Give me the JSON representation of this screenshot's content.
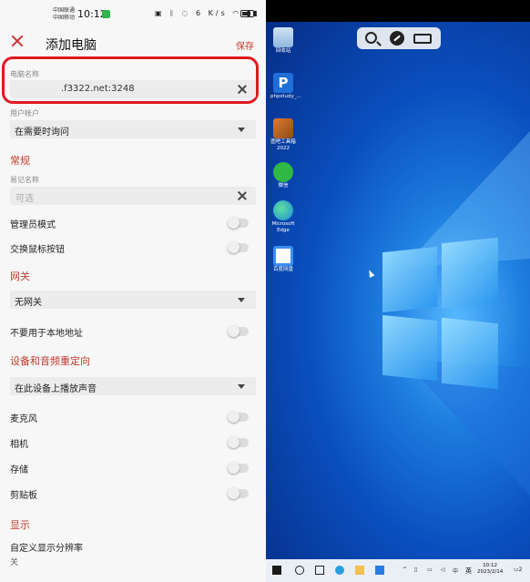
{
  "status_bar": {
    "carrier1": "中国联通",
    "carrier2": "中国移动",
    "time": "10:12",
    "speed": "6 K/s",
    "battery": "75"
  },
  "app_bar": {
    "title": "添加电脑",
    "save_label": "保存"
  },
  "form": {
    "pc_name_label": "电脑名称",
    "pc_name_value": ".f3322.net:3248",
    "user_account_label": "用户帐户",
    "user_account_value": "在需要时询问",
    "general_title": "常规",
    "friendly_name_label": "易记名称",
    "friendly_name_placeholder": "可选",
    "admin_mode_label": "管理员模式",
    "swap_mouse_label": "交换鼠标按钮",
    "gateway_title": "网关",
    "gateway_value": "无网关",
    "bypass_local_label": "不要用于本地地址",
    "redirect_title": "设备和音频重定向",
    "sound_value": "在此设备上播放声音",
    "mic_label": "麦克风",
    "camera_label": "相机",
    "storage_label": "存储",
    "clipboard_label": "剪贴板",
    "display_title": "显示",
    "custom_res_label": "自定义显示分辨率",
    "custom_res_value": "关"
  },
  "toggles": {
    "admin_mode": false,
    "swap_mouse": false,
    "bypass_local": false,
    "microphone": false,
    "camera": false,
    "storage": false,
    "clipboard": false
  },
  "remote_desktop": {
    "icons": [
      {
        "label": "回收站"
      },
      {
        "label": "phpstudy_..."
      },
      {
        "label": "图吧工具箱2022"
      },
      {
        "label": "微信"
      },
      {
        "label": "Microsoft Edge"
      },
      {
        "label": "百度网盘"
      }
    ],
    "taskbar": {
      "lang": "英",
      "time": "10:12",
      "date": "2023/2/14",
      "notification_count": "2"
    }
  },
  "colors": {
    "accent": "#c0392b",
    "highlight_border": "#e0191d",
    "desktop_blue": "#0a4fbf"
  }
}
